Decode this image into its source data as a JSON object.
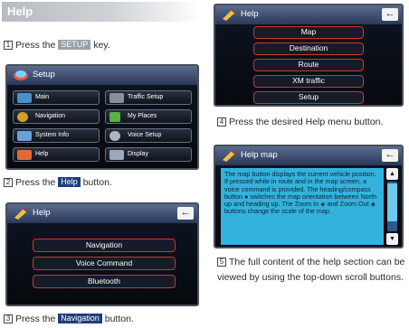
{
  "header": {
    "title": "Help"
  },
  "steps": {
    "s1": {
      "num": "1",
      "pre": "Press the",
      "key": "SETUP",
      "post": "key."
    },
    "s2": {
      "num": "2",
      "pre": "Press the",
      "key": "Help",
      "post": "button."
    },
    "s3": {
      "num": "3",
      "pre": "Press the",
      "key": "Navigation",
      "post": "button."
    },
    "s4": {
      "num": "4",
      "text": "Press the desired Help menu button."
    },
    "s5": {
      "num": "5",
      "text": "The full content of the help section can be viewed by using the top-down scroll buttons."
    }
  },
  "setup_screen": {
    "title": "Setup",
    "buttons": [
      "Main",
      "Traffic Setup",
      "Navigation",
      "My Places",
      "System Info",
      "Voice Setup",
      "Help",
      "Display"
    ]
  },
  "help_screen_small": {
    "title": "Help",
    "buttons": [
      "Navigation",
      "Voice Command",
      "Bluetooth"
    ]
  },
  "help_screen_top": {
    "title": "Help",
    "buttons": [
      "Map",
      "Destination",
      "Route",
      "XM traffic",
      "Setup"
    ]
  },
  "help_map_screen": {
    "title": "Help map",
    "text": "The map button displays the current vehicle position. If pressed while in route and in the map screen, a voice command is provided. The heading/compass button ● switches the map orientation between North up and heading up. The Zoom In ◈ and Zoom Out ◈ buttons change the scale of the map."
  },
  "icons": {
    "back": "←",
    "up": "▲",
    "down": "▼"
  },
  "colors": {
    "accent_red": "#c33a2a",
    "text_blue": "#33b2dc",
    "key_navy": "#1f3f7a"
  }
}
